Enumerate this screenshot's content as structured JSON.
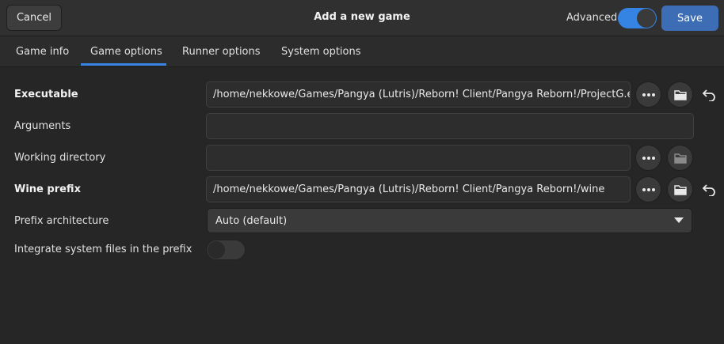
{
  "header": {
    "cancel_label": "Cancel",
    "title": "Add a new game",
    "advanced_label": "Advanced",
    "advanced_on": true,
    "save_label": "Save",
    "accent": "#3584e4"
  },
  "tabs": [
    {
      "label": "Game info",
      "active": false
    },
    {
      "label": "Game options",
      "active": true
    },
    {
      "label": "Runner options",
      "active": false
    },
    {
      "label": "System options",
      "active": false
    }
  ],
  "form": {
    "executable": {
      "label": "Executable",
      "value": "/home/nekkowe/Games/Pangya (Lutris)/Reborn! Client/Pangya Reborn!/ProjectG.exe"
    },
    "arguments": {
      "label": "Arguments",
      "value": ""
    },
    "working_directory": {
      "label": "Working directory",
      "value": ""
    },
    "wine_prefix": {
      "label": "Wine prefix",
      "value": "/home/nekkowe/Games/Pangya (Lutris)/Reborn! Client/Pangya Reborn!/wine"
    },
    "prefix_architecture": {
      "label": "Prefix architecture",
      "selected": "Auto (default)"
    },
    "integrate_system_files": {
      "label": "Integrate system files in the prefix",
      "enabled": false
    }
  },
  "icons": {
    "more": "more-icon",
    "folder": "folder-icon",
    "reset": "undo-icon",
    "dropdown": "chevron-down-icon"
  }
}
